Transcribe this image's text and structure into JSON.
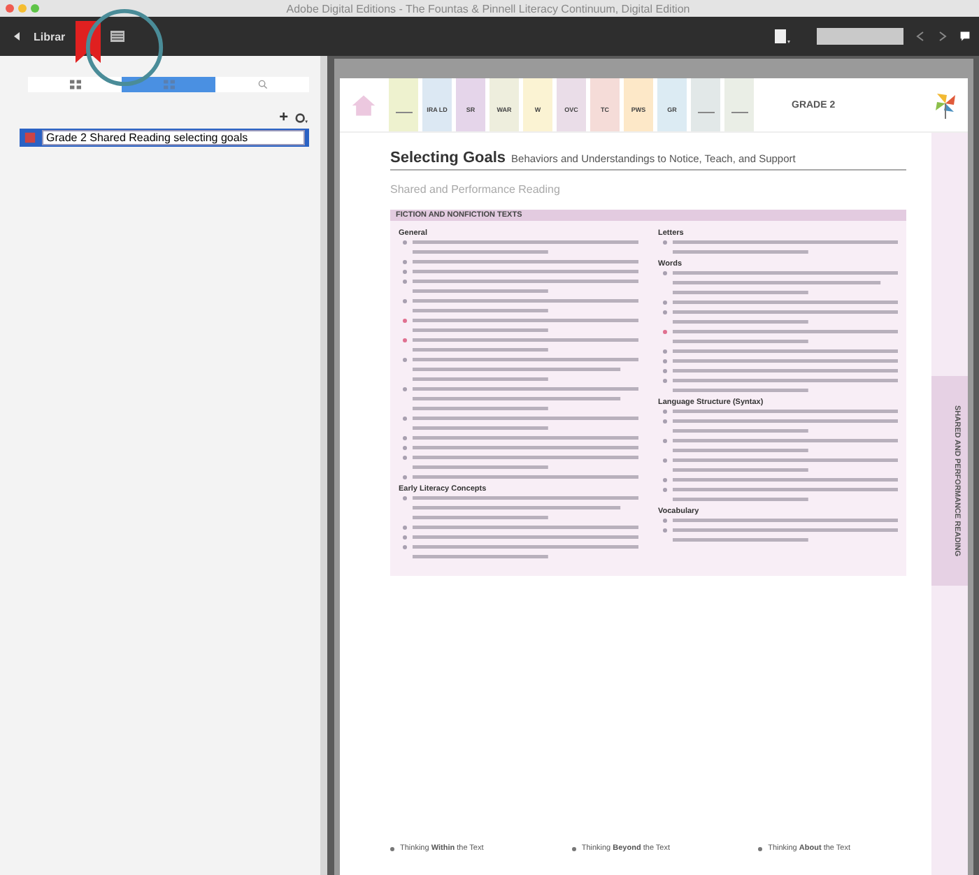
{
  "window": {
    "title": "Adobe Digital Editions - The Fountas & Pinnell Literacy Continuum, Digital Edition"
  },
  "toolbar": {
    "library_label": "Librar"
  },
  "panel_tabs": [
    {
      "kind": "thumbnails",
      "selected": false
    },
    {
      "kind": "bookmarks",
      "selected": true
    },
    {
      "kind": "search",
      "selected": false
    }
  ],
  "panel_actions": {
    "add": "+"
  },
  "bookmarks": [
    {
      "value": "Grade 2 Shared Reading selecting goals",
      "selected": true
    }
  ],
  "page": {
    "tabs": [
      {
        "kind": "blank",
        "color": "#eef2cf"
      },
      {
        "kind": "label",
        "label": "IRA LD",
        "color": "#dce8f3"
      },
      {
        "kind": "label",
        "label": "SR",
        "color": "#e5d5ea"
      },
      {
        "kind": "label",
        "label": "WAR",
        "color": "#eeeedd"
      },
      {
        "kind": "label",
        "label": "W",
        "color": "#fbf3d3"
      },
      {
        "kind": "label",
        "label": "OVC",
        "color": "#eadde8"
      },
      {
        "kind": "label",
        "label": "TC",
        "color": "#f5dcd8"
      },
      {
        "kind": "label",
        "label": "PWS",
        "color": "#fde8c8"
      },
      {
        "kind": "label",
        "label": "GR",
        "color": "#dcebf3"
      },
      {
        "kind": "blank",
        "color": "#e2e8e8"
      },
      {
        "kind": "blank",
        "color": "#eaeee6"
      }
    ],
    "grade": "GRADE 2",
    "heading": "Selecting Goals",
    "subheading": "Behaviors and Understandings to Notice, Teach, and Support",
    "section_title": "Shared and Performance Reading",
    "band_title": "FICTION AND NONFICTION TEXTS",
    "columns": [
      [
        {
          "title": "General",
          "items": [
            {
              "kind": "two_line",
              "color": "#a8a0b0"
            },
            {
              "kind": "one_line",
              "color": "#a8a0b0"
            },
            {
              "kind": "one_line",
              "color": "#a8a0b0"
            },
            {
              "kind": "two_line",
              "color": "#a8a0b0"
            },
            {
              "kind": "two_line",
              "color": "#a8a0b0"
            },
            {
              "kind": "two_line",
              "color": "#e07090"
            },
            {
              "kind": "two_line",
              "color": "#e07090"
            },
            {
              "kind": "three_line",
              "color": "#a8a0b0"
            },
            {
              "kind": "three_line",
              "color": "#a8a0b0"
            },
            {
              "kind": "two_line",
              "color": "#a8a0b0"
            },
            {
              "kind": "one_line",
              "color": "#a8a0b0"
            },
            {
              "kind": "one_line",
              "color": "#a8a0b0"
            },
            {
              "kind": "two_line",
              "color": "#a8a0b0"
            },
            {
              "kind": "one_line",
              "color": "#a8a0b0"
            }
          ]
        },
        {
          "title": "Early Literacy Concepts",
          "items": [
            {
              "kind": "three_line",
              "color": "#a8a0b0"
            },
            {
              "kind": "one_line",
              "color": "#a8a0b0"
            },
            {
              "kind": "one_line",
              "color": "#a8a0b0"
            },
            {
              "kind": "two_line",
              "color": "#a8a0b0"
            }
          ]
        }
      ],
      [
        {
          "title": "Letters",
          "items": [
            {
              "kind": "two_line",
              "color": "#a8a0b0"
            }
          ]
        },
        {
          "title": "Words",
          "items": [
            {
              "kind": "three_line",
              "color": "#a8a0b0"
            },
            {
              "kind": "one_line",
              "color": "#a8a0b0"
            },
            {
              "kind": "two_line",
              "color": "#a8a0b0"
            },
            {
              "kind": "two_line",
              "color": "#e07090"
            },
            {
              "kind": "one_line",
              "color": "#a8a0b0"
            },
            {
              "kind": "one_line",
              "color": "#a8a0b0"
            },
            {
              "kind": "one_line",
              "color": "#a8a0b0"
            },
            {
              "kind": "two_line",
              "color": "#a8a0b0"
            }
          ]
        },
        {
          "title": "Language Structure (Syntax)",
          "items": [
            {
              "kind": "one_line",
              "color": "#a8a0b0"
            },
            {
              "kind": "two_line",
              "color": "#a8a0b0"
            },
            {
              "kind": "two_line",
              "color": "#a8a0b0"
            },
            {
              "kind": "two_line",
              "color": "#a8a0b0"
            },
            {
              "kind": "one_line",
              "color": "#a8a0b0"
            },
            {
              "kind": "two_line",
              "color": "#a8a0b0"
            }
          ]
        },
        {
          "title": "Vocabulary",
          "items": [
            {
              "kind": "one_line",
              "color": "#a8a0b0"
            },
            {
              "kind": "two_line",
              "color": "#a8a0b0"
            }
          ]
        }
      ]
    ],
    "side_tab": "SHARED AND PERFORMANCE READING",
    "footer": [
      "Thinking **Within** the Text",
      "Thinking **Beyond** the Text",
      "Thinking **About** the Text"
    ]
  }
}
